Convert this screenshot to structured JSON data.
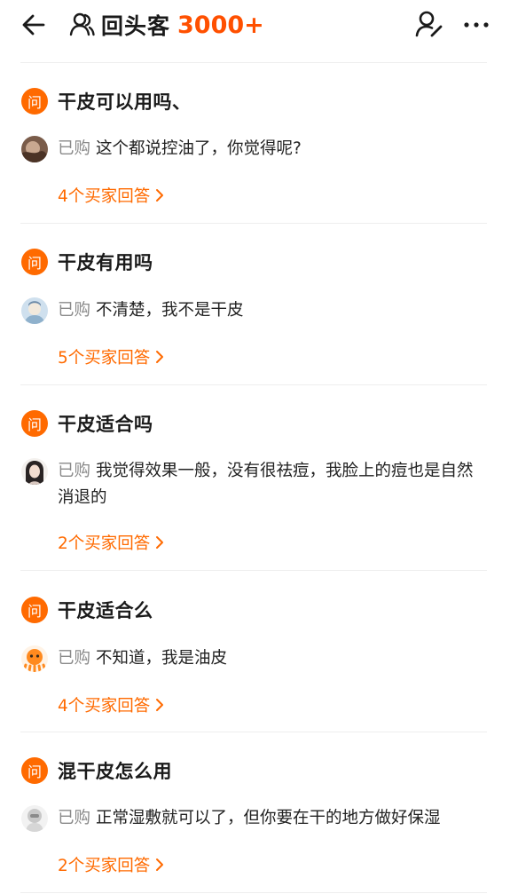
{
  "header": {
    "title": "回头客",
    "count": "3000+"
  },
  "questions": [
    {
      "badge": "问",
      "question": "干皮可以用吗、",
      "bought_label": "已购",
      "answer": "这个都说控油了，你觉得呢?",
      "answers_link": "4个买家回答"
    },
    {
      "badge": "问",
      "question": "干皮有用吗",
      "bought_label": "已购",
      "answer": "不清楚，我不是干皮",
      "answers_link": "5个买家回答"
    },
    {
      "badge": "问",
      "question": "干皮适合吗",
      "bought_label": "已购",
      "answer": "我觉得效果一般，没有很祛痘，我脸上的痘也是自然消退的",
      "answers_link": "2个买家回答"
    },
    {
      "badge": "问",
      "question": "干皮适合么",
      "bought_label": "已购",
      "answer": "不知道，我是油皮",
      "answers_link": "4个买家回答"
    },
    {
      "badge": "问",
      "question": "混干皮怎么用",
      "bought_label": "已购",
      "answer": "正常湿敷就可以了，但你要在干的地方做好保湿",
      "answers_link": "2个买家回答"
    }
  ],
  "colors": {
    "accent": "#ff6a00",
    "title_count": "#ff5000",
    "muted": "#8a8a8a"
  }
}
